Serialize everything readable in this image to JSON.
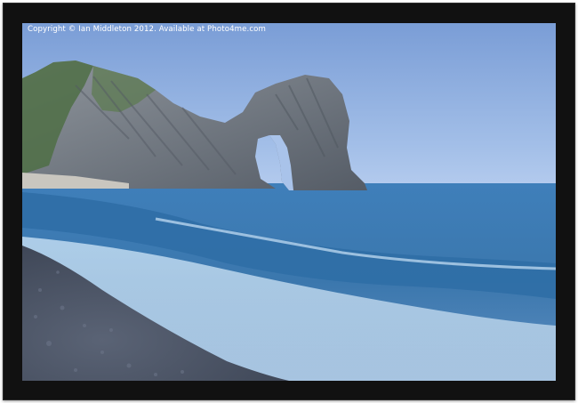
{
  "image": {
    "watermark": "Copyright © Ian Middleton 2012. Available at Photo4me.com",
    "subject": "Durdle Door sea arch at dusk with pebble beach and breaking wave"
  },
  "colors": {
    "frame": "#111111",
    "sky_top": "#7c9fd8",
    "sky_horizon": "#a9c3ea",
    "sea": "#3d7db6",
    "pebbles": "#4a5466"
  }
}
